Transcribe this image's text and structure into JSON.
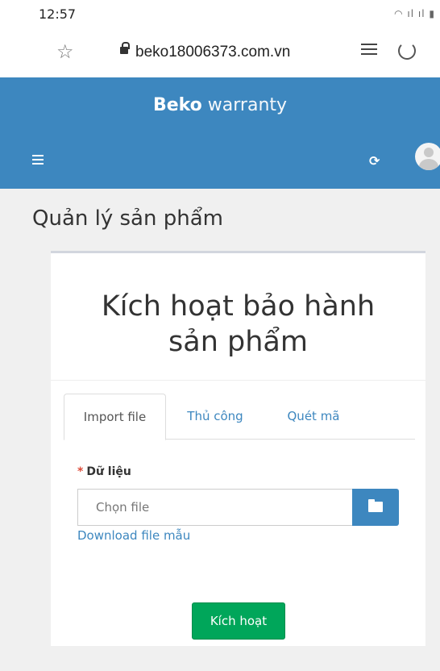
{
  "status_bar": {
    "time": "12:57",
    "icons": "wifi-icon signal-icon signal-icon battery-icon"
  },
  "browser": {
    "url": "beko18006373.com.vn",
    "icons": [
      "star-icon",
      "lock-icon",
      "reader-mode-icon",
      "reload-icon"
    ]
  },
  "header": {
    "brand_bold": "Beko",
    "brand_light": "warranty",
    "color": "#3d87bf",
    "icons": [
      "menu-icon",
      "refresh-icon",
      "avatar"
    ]
  },
  "page": {
    "title": "Quản lý sản phẩm"
  },
  "card": {
    "title_line1": "Kích hoạt bảo hành",
    "title_line2": "sản phẩm",
    "tabs": [
      {
        "label": "Import file",
        "active": true
      },
      {
        "label": "Thủ công",
        "active": false
      },
      {
        "label": "Quét mã",
        "active": false
      }
    ],
    "field": {
      "required_mark": "*",
      "label": "Dữ liệu",
      "placeholder": "Chọn file"
    },
    "download_link": "Download file mẫu",
    "submit_label": "Kích hoạt",
    "submit_color": "#00a65a"
  }
}
